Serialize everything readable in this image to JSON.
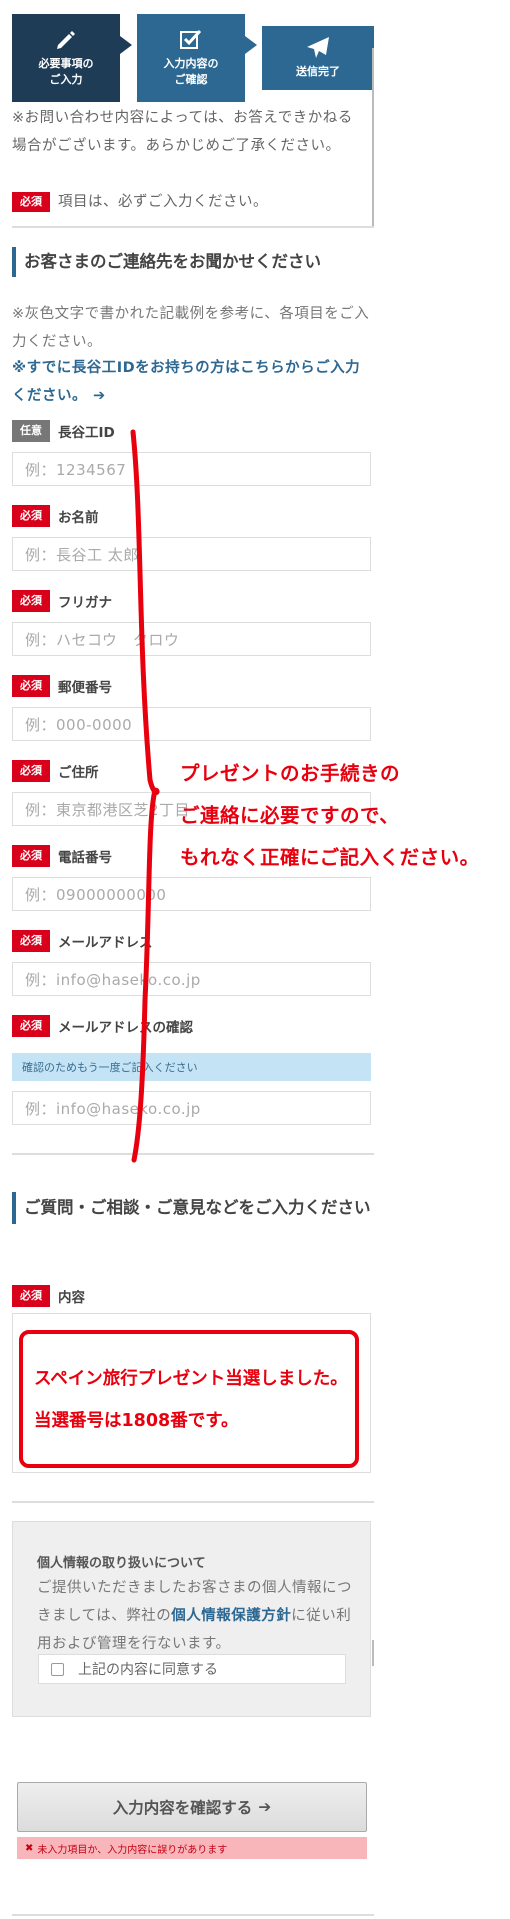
{
  "steps": [
    {
      "label_line1": "必要事項の",
      "label_line2": "ご入力",
      "icon": "pencil-icon"
    },
    {
      "label_line1": "入力内容の",
      "label_line2": "ご確認",
      "icon": "checkbox-edit-icon"
    },
    {
      "label_line1": "送信完了",
      "label_line2": "",
      "icon": "paper-plane-icon"
    }
  ],
  "notice": "※お問い合わせ内容によっては、お答えできかねる場合がございます。あらかじめご了承ください。",
  "required_line": {
    "badge": "必須",
    "text": "項目は、必ずご入力ください。"
  },
  "contact_section": {
    "heading": "お客さまのご連絡先をお聞かせください",
    "description": "※灰色文字で書かれた記載例を参考に、各項目をご入力ください。",
    "link": "※すでに長谷工IDをお持ちの方はこちらからご入力ください。",
    "link_arrow": "➔"
  },
  "fields": [
    {
      "badge": "任意",
      "label": "長谷工ID",
      "placeholder": "例：1234567"
    },
    {
      "badge": "必須",
      "label": "お名前",
      "placeholder": "例：長谷工 太郎"
    },
    {
      "badge": "必須",
      "label": "フリガナ",
      "placeholder": "例：ハセコウ　タロウ"
    },
    {
      "badge": "必須",
      "label": "郵便番号",
      "placeholder": "例：000-0000"
    },
    {
      "badge": "必須",
      "label": "ご住所",
      "placeholder": "例：東京都港区芝2丁目"
    },
    {
      "badge": "必須",
      "label": "電話番号",
      "placeholder": "例：09000000000"
    },
    {
      "badge": "必須",
      "label": "メールアドレス",
      "placeholder": "例：info@haseko.co.jp"
    },
    {
      "badge": "必須",
      "label": "メールアドレスの確認",
      "placeholder": "例：info@haseko.co.jp"
    }
  ],
  "confirm_note": "確認のためもう一度ご記入ください",
  "inquiry_section": {
    "heading": "ご質問・ご相談・ご意見などをご入力ください",
    "badge": "必須",
    "label": "内容",
    "content_line1": "スペイン旅行プレゼント当選しました。",
    "content_line2": "当選番号は1808番です。"
  },
  "annotation": {
    "line1": "プレゼントのお手続きの",
    "line2": "ご連絡に必要ですので、",
    "line3": "もれなく正確にご記入ください。"
  },
  "privacy": {
    "title": "個人情報の取り扱いについて",
    "body_before": "ご提供いただきましたお客さまの個人情報につきましては、弊社の",
    "policy_link": "個人情報保護方針",
    "body_after": "に従い利用および管理を行ないます。",
    "agree_label": "上記の内容に同意する"
  },
  "submit": {
    "label": "入力内容を確認する",
    "arrow": "➔"
  },
  "error": {
    "icon": "✖",
    "text": "未入力項目か、入力内容に誤りがあります"
  },
  "colors": {
    "navy": "#1f3c57",
    "blue": "#2d6892",
    "required_red": "#d9001b",
    "annotation_red": "#e8000e"
  }
}
